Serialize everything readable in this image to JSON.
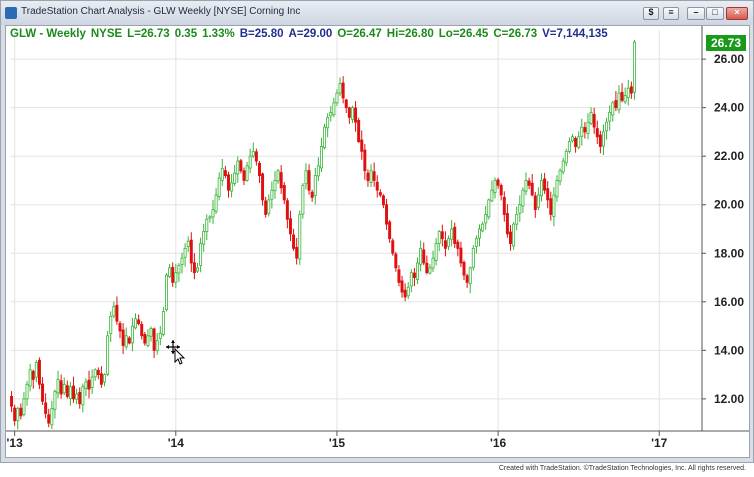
{
  "window": {
    "title": "TradeStation Chart Analysis - GLW Weekly [NYSE] Corning Inc",
    "buttons": {
      "dollar": "$",
      "menu": "≡",
      "minimize": "–",
      "maximize": "□",
      "close": "×"
    }
  },
  "header": [
    {
      "text": "GLW - Weekly",
      "color": "#1a8a1a"
    },
    {
      "text": "NYSE",
      "color": "#1a8a1a"
    },
    {
      "text": "L=26.73",
      "color": "#1a8a1a"
    },
    {
      "text": "0.35",
      "color": "#1a8a1a"
    },
    {
      "text": "1.33%",
      "color": "#1a8a1a"
    },
    {
      "text": "B=25.80",
      "color": "#1f2f8c"
    },
    {
      "text": "A=29.00",
      "color": "#1f2f8c"
    },
    {
      "text": "O=26.47",
      "color": "#1a8a1a"
    },
    {
      "text": "Hi=26.80",
      "color": "#1a8a1a"
    },
    {
      "text": "Lo=26.45",
      "color": "#1a8a1a"
    },
    {
      "text": "C=26.73",
      "color": "#1a8a1a"
    },
    {
      "text": "V=7,144,135",
      "color": "#1f2f8c"
    }
  ],
  "last_price_badge": "26.73",
  "footer": "Created with TradeStation. ©TradeStation Technologies, Inc. All rights reserved.",
  "colors": {
    "up": "#39b539",
    "down": "#e01010",
    "badge": "#1a9a1a",
    "grid": "#e3e3e3"
  },
  "chart_data": {
    "type": "candlestick",
    "y_ticks": [
      "12.00",
      "14.00",
      "16.00",
      "18.00",
      "20.00",
      "22.00",
      "24.00",
      "26.00"
    ],
    "x_ticks": [
      "'13",
      "'14",
      "'15",
      "'16",
      "'17"
    ],
    "ylim": [
      10.8,
      27.2
    ],
    "x_tick_positions": [
      1,
      53,
      105,
      157,
      209
    ],
    "n_weeks": 222,
    "series_closes": [
      11.7,
      11.1,
      11.6,
      11.3,
      12.0,
      12.6,
      13.2,
      12.8,
      13.5,
      12.6,
      11.9,
      11.4,
      11.0,
      11.6,
      12.3,
      12.8,
      12.2,
      12.6,
      12.1,
      12.5,
      12.0,
      12.2,
      11.8,
      12.5,
      12.7,
      12.4,
      12.9,
      13.2,
      13.0,
      12.6,
      13.0,
      14.6,
      15.4,
      15.8,
      15.2,
      14.8,
      14.2,
      14.6,
      14.3,
      15.0,
      15.3,
      15.1,
      14.6,
      14.3,
      14.6,
      14.9,
      14.0,
      14.4,
      14.7,
      15.6,
      17.1,
      17.4,
      16.8,
      17.2,
      17.5,
      17.8,
      18.2,
      18.5,
      17.6,
      17.2,
      17.4,
      18.4,
      18.9,
      19.4,
      19.5,
      19.8,
      20.4,
      21.1,
      21.5,
      21.2,
      20.6,
      20.9,
      21.3,
      21.8,
      21.4,
      21.0,
      21.6,
      22.0,
      22.2,
      21.8,
      21.2,
      20.2,
      19.6,
      20.2,
      20.6,
      21.0,
      21.4,
      20.7,
      20.2,
      19.4,
      18.8,
      18.2,
      17.8,
      19.6,
      20.8,
      21.4,
      20.6,
      20.3,
      21.2,
      21.6,
      22.4,
      23.2,
      23.6,
      23.8,
      24.2,
      24.6,
      25.0,
      24.4,
      24.0,
      23.6,
      24.0,
      23.4,
      22.6,
      22.2,
      21.4,
      21.0,
      21.4,
      21.0,
      20.6,
      20.4,
      20.0,
      19.2,
      18.6,
      18.0,
      17.4,
      16.8,
      16.4,
      16.2,
      16.6,
      17.2,
      17.0,
      17.6,
      18.2,
      17.6,
      17.2,
      17.4,
      17.8,
      18.4,
      18.9,
      18.6,
      18.2,
      18.6,
      19.0,
      18.4,
      18.2,
      17.6,
      17.1,
      16.8,
      17.4,
      18.2,
      18.6,
      19.0,
      19.2,
      19.6,
      20.2,
      20.6,
      21.0,
      20.8,
      20.4,
      19.6,
      18.8,
      18.4,
      19.2,
      19.6,
      20.0,
      20.6,
      21.0,
      20.8,
      20.4,
      19.8,
      20.4,
      21.0,
      20.6,
      20.2,
      19.6,
      20.4,
      21.0,
      21.4,
      21.8,
      22.2,
      22.6,
      22.8,
      22.4,
      22.8,
      23.2,
      23.0,
      23.4,
      23.8,
      23.2,
      22.8,
      22.4,
      23.0,
      23.4,
      23.8,
      24.2,
      24.0,
      24.6,
      24.3,
      24.5,
      24.8,
      24.6,
      26.7
    ]
  }
}
